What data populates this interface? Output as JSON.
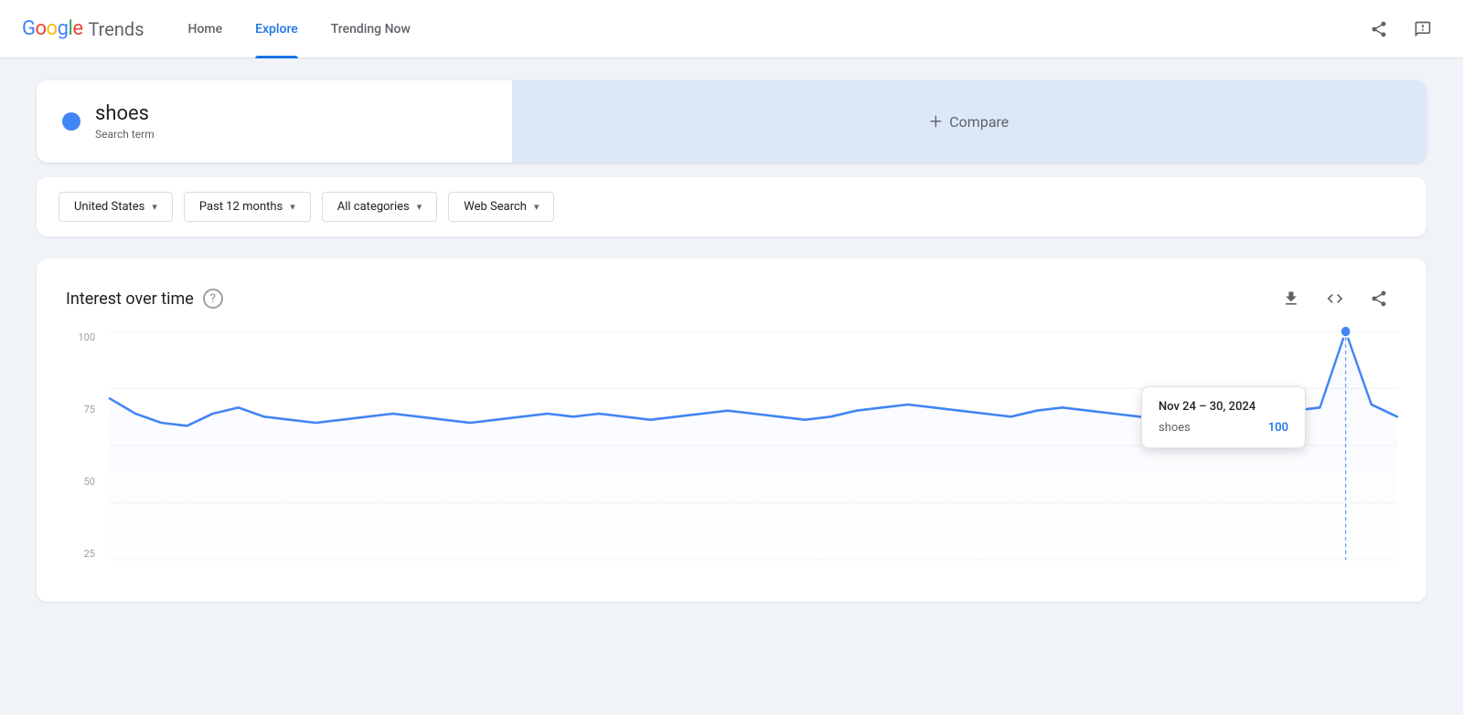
{
  "header": {
    "logo_google": "Google",
    "logo_trends": "Trends",
    "nav": [
      {
        "id": "home",
        "label": "Home",
        "active": false
      },
      {
        "id": "explore",
        "label": "Explore",
        "active": true
      },
      {
        "id": "trending-now",
        "label": "Trending Now",
        "active": false
      }
    ],
    "share_icon": "share",
    "feedback_icon": "feedback"
  },
  "search": {
    "term": "shoes",
    "label": "Search term",
    "dot_color": "#4285F4"
  },
  "compare": {
    "label": "Compare",
    "plus": "+"
  },
  "filters": [
    {
      "id": "region",
      "label": "United States",
      "has_arrow": true
    },
    {
      "id": "time",
      "label": "Past 12 months",
      "has_arrow": true
    },
    {
      "id": "category",
      "label": "All categories",
      "has_arrow": true
    },
    {
      "id": "search_type",
      "label": "Web Search",
      "has_arrow": true
    }
  ],
  "chart": {
    "title": "Interest over time",
    "help": "?",
    "download_icon": "⬇",
    "embed_icon": "<>",
    "share_icon": "share",
    "y_labels": [
      "100",
      "75",
      "50",
      "25"
    ],
    "tooltip": {
      "date": "Nov 24 – 30, 2024",
      "term": "shoes",
      "value": "100"
    },
    "data_points": [
      78,
      73,
      70,
      69,
      73,
      75,
      72,
      71,
      70,
      71,
      72,
      73,
      72,
      71,
      70,
      71,
      72,
      73,
      72,
      73,
      72,
      71,
      72,
      73,
      74,
      73,
      72,
      71,
      72,
      74,
      75,
      76,
      75,
      74,
      73,
      72,
      74,
      75,
      74,
      73,
      72,
      71,
      72,
      73,
      72,
      73,
      74,
      75,
      100,
      76,
      72
    ]
  }
}
